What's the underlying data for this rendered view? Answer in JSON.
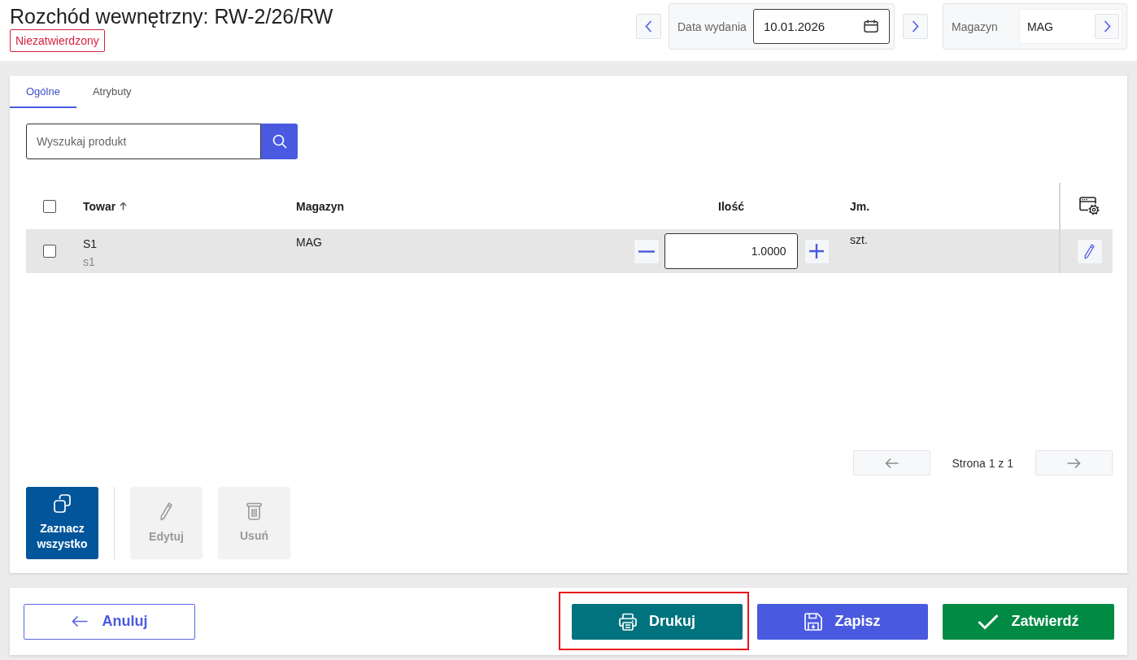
{
  "header": {
    "title": "Rozchód wewnętrzny: RW-2/26/RW",
    "status": "Niezatwierdzony",
    "date": {
      "label": "Data wydania",
      "value": "10.01.2026"
    },
    "warehouse": {
      "label": "Magazyn",
      "value": "MAG"
    }
  },
  "tabs": [
    {
      "label": "Ogólne",
      "selected": true
    },
    {
      "label": "Atrybuty",
      "selected": false
    }
  ],
  "search": {
    "placeholder": "Wyszukaj produkt"
  },
  "table": {
    "select_all_checked": false,
    "columns": [
      {
        "label": "Towar",
        "sorted": true
      },
      {
        "label": "Magazyn",
        "sorted": false
      },
      {
        "label": "Ilość",
        "sorted": false
      },
      {
        "label": "Jm.",
        "sorted": false
      }
    ],
    "rows": [
      {
        "checked": false,
        "name": "S1",
        "code": "s1",
        "warehouse": "MAG",
        "quantity": "1.0000",
        "unit": "szt."
      }
    ]
  },
  "pagination": {
    "label": "Strona 1 z 1",
    "prev_disabled": true,
    "next_disabled": true
  },
  "actions": [
    {
      "kind": "select_all",
      "label": "Zaznacz wszystko",
      "disabled": false
    },
    {
      "kind": "edit",
      "label": "Edytuj",
      "disabled": true
    },
    {
      "kind": "delete",
      "label": "Usuń",
      "disabled": true
    }
  ],
  "footer": [
    {
      "kind": "cancel",
      "label": "Anuluj",
      "highlighted": false
    },
    {
      "kind": "print",
      "label": "Drukuj",
      "highlighted": true
    },
    {
      "kind": "save",
      "label": "Zapisz",
      "highlighted": false
    },
    {
      "kind": "confirm",
      "label": "Zatwierdź",
      "highlighted": false
    }
  ]
}
